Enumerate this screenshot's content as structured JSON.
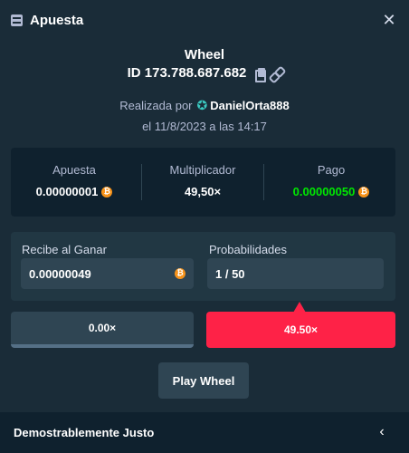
{
  "modal": {
    "title": "Apuesta",
    "icon": "bet-slip-icon",
    "close_icon": "close-icon"
  },
  "bet": {
    "game": "Wheel",
    "id": "ID 173.788.687.682",
    "placed_by_label": "Realizada por",
    "user": "DanielOrta888",
    "date": "el 11/8/2023 a las 14:17"
  },
  "stats": {
    "bet_label": "Apuesta",
    "bet_value": "0.00000001",
    "multiplier_label": "Multiplicador",
    "multiplier_value": "49,50×",
    "payout_label": "Pago",
    "payout_value": "0.00000050",
    "payout_color": "#00e701"
  },
  "details": {
    "profit_label": "Recibe al Ganar",
    "profit_value": "0.00000049",
    "chance_label": "Probabilidades",
    "chance_value": "1 / 50"
  },
  "segments": [
    {
      "label": "0.00×",
      "color": "#2f4553"
    },
    {
      "label": "49.50×",
      "color": "#fe2247"
    }
  ],
  "play_button": "Play Wheel",
  "footer": {
    "label": "Demostrablemente Justo"
  },
  "currency_symbol": "₿"
}
